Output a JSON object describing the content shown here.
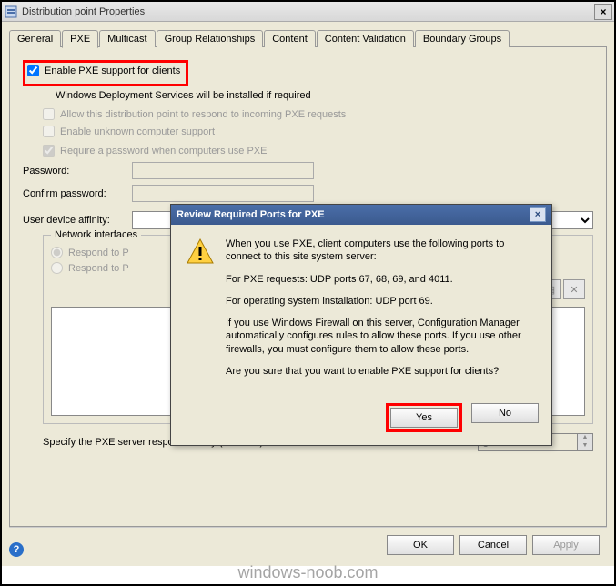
{
  "window": {
    "title": "Distribution point Properties",
    "close": "×"
  },
  "tabs": {
    "general": "General",
    "pxe": "PXE",
    "multicast": "Multicast",
    "group": "Group Relationships",
    "content": "Content",
    "validation": "Content Validation",
    "boundary": "Boundary Groups"
  },
  "pxe": {
    "enable_label": "Enable PXE support for clients",
    "wds_note": "Windows Deployment Services will be installed if required",
    "allow_respond": "Allow this distribution point to respond to incoming PXE requests",
    "unknown": "Enable unknown computer support",
    "require_pwd": "Require a password when computers use PXE",
    "password_label": "Password:",
    "confirm_label": "Confirm password:",
    "affinity_label": "User device affinity:",
    "affinity_value": "",
    "fieldset_label": "Network interfaces",
    "radio_all": "Respond to P",
    "radio_specific": "Respond to P",
    "delay_label": "Specify the PXE server response delay (seconds):",
    "delay_value": "0"
  },
  "modal": {
    "title": "Review Required Ports for PXE",
    "p1": "When you use PXE, client computers use the following ports to connect to this site system server:",
    "p2": "For PXE requests: UDP ports 67, 68, 69, and 4011.",
    "p3": "For operating system installation: UDP port 69.",
    "p4": "If you use Windows Firewall on this server, Configuration Manager automatically configures rules to allow these ports. If you use other firewalls, you must configure them to allow these ports.",
    "p5": "Are you sure that you want to enable PXE support for clients?",
    "yes": "Yes",
    "no": "No",
    "close": "×"
  },
  "buttons": {
    "ok": "OK",
    "cancel": "Cancel",
    "apply": "Apply"
  },
  "watermark": "windows-noob.com"
}
